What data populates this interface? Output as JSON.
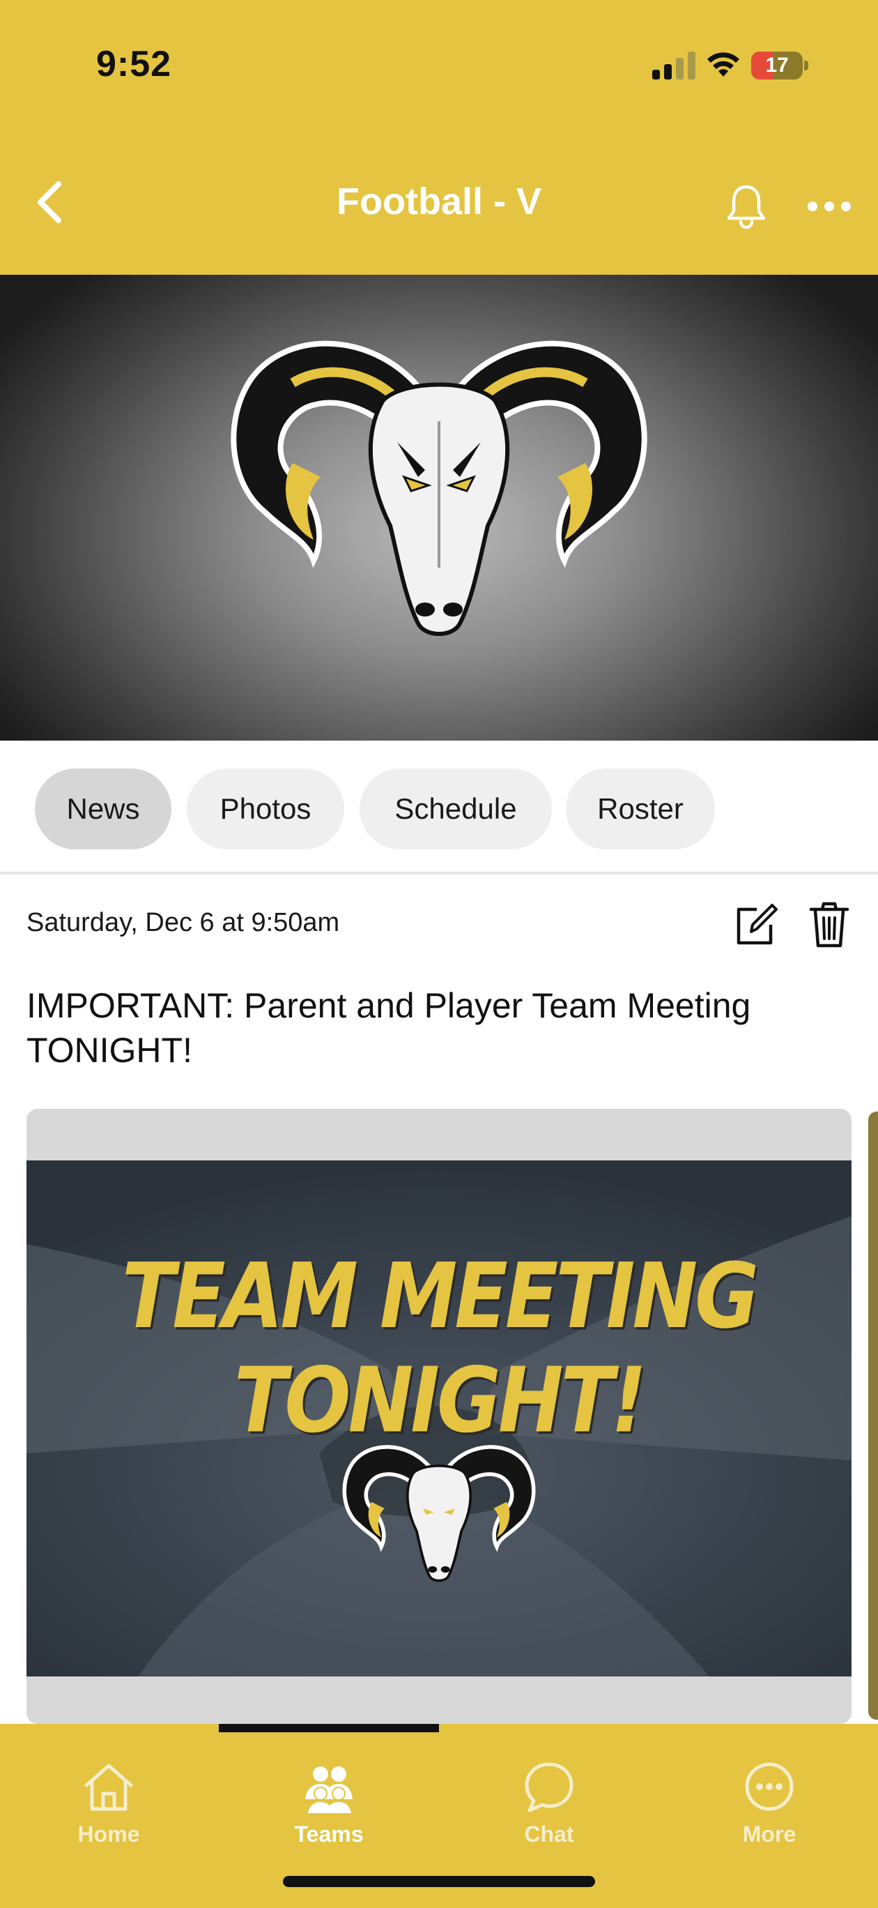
{
  "status_bar": {
    "time": "9:52",
    "battery_level": "17",
    "battery_fraction": 0.17
  },
  "header": {
    "title": "Football - V"
  },
  "tabs": [
    {
      "label": "News",
      "active": true
    },
    {
      "label": "Photos",
      "active": false
    },
    {
      "label": "Schedule",
      "active": false
    },
    {
      "label": "Roster",
      "active": false
    }
  ],
  "post": {
    "date": "Saturday, Dec 6 at 9:50am",
    "title": "IMPORTANT: Parent and Player Team Meeting TONIGHT!",
    "image_text": "TEAM MEETING TONIGHT!"
  },
  "bottom_nav": [
    {
      "label": "Home",
      "icon": "home-icon",
      "active": false
    },
    {
      "label": "Teams",
      "icon": "teams-icon",
      "active": true
    },
    {
      "label": "Chat",
      "icon": "chat-icon",
      "active": false
    },
    {
      "label": "More",
      "icon": "more-circle-icon",
      "active": false
    }
  ],
  "colors": {
    "brand_gold": "#e4c441",
    "header_text": "#ffffff",
    "dark": "#111111"
  }
}
